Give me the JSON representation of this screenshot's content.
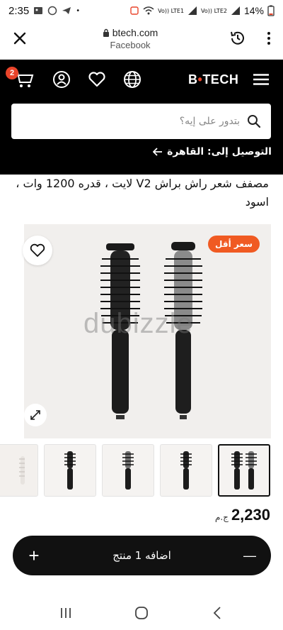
{
  "status": {
    "time": "2:35",
    "network1": "Vo)) LTE1",
    "network2": "Vo)) LTE2",
    "battery": "14%"
  },
  "browser": {
    "url": "btech.com",
    "source": "Facebook"
  },
  "header": {
    "cart_count": "2",
    "logo_left": "B",
    "logo_dot": "•",
    "logo_right": "TECH",
    "search_placeholder": "بتدور على إيه؟",
    "delivery_text": "التوصيل إلى: القاهرة"
  },
  "product": {
    "title": "مصفف شعر راش براش V2 لايت ، قدره 1200 وات ، اسود",
    "badge": "سعر أقل",
    "watermark": "dubizzle",
    "price": "2,230",
    "currency": "ج.م"
  },
  "cart_bar": {
    "add_label": "اضافه 1 منتج",
    "plus": "+",
    "minus": "—"
  },
  "colors": {
    "accent": "#f05a22",
    "header_bg": "#000000",
    "badge_red": "#e9442a"
  }
}
